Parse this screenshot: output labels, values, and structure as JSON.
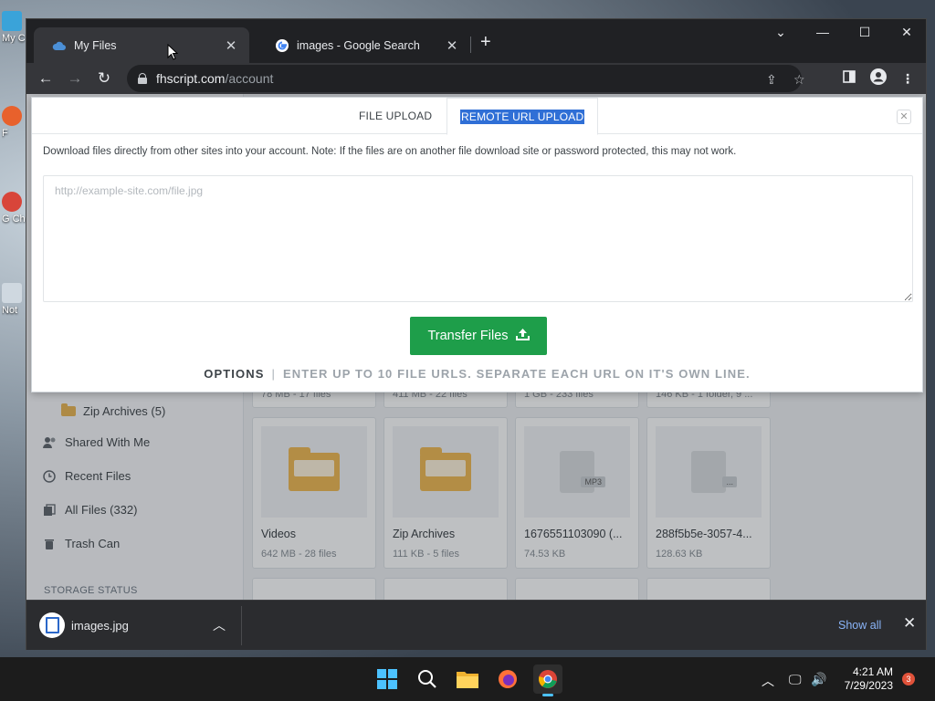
{
  "desktop": {
    "icons": [
      {
        "label": "My C"
      },
      {
        "label": "F"
      },
      {
        "label": "G Ch"
      },
      {
        "label": "Not"
      }
    ]
  },
  "browser": {
    "tabs": [
      {
        "title": "My Files",
        "close": "✕"
      },
      {
        "title": "images - Google Search",
        "close": "✕"
      }
    ],
    "new_tab": "+",
    "window_controls": {
      "tab_search": "⌄",
      "minimize": "—",
      "maximize": "☐",
      "close": "✕"
    },
    "url_host": "fhscript.com",
    "url_path": "/account"
  },
  "sidebar": {
    "zip_archives": "Zip Archives (5)",
    "shared_with_me": "Shared With Me",
    "recent_files": "Recent Files",
    "all_files": "All Files (332)",
    "trash_can": "Trash Can",
    "storage_status": "STORAGE STATUS"
  },
  "grid": {
    "top_row_meta": [
      "78 MB - 17 files",
      "411 MB - 22 files",
      "1 GB - 233 files",
      "146 KB - 1 folder, 9 ..."
    ],
    "cards": [
      {
        "name": "Videos",
        "meta": "642 MB - 28 files",
        "kind": "folder"
      },
      {
        "name": "Zip Archives",
        "meta": "111 KB - 5 files",
        "kind": "folder"
      },
      {
        "name": "1676551103090 (...",
        "meta": "74.53 KB",
        "kind": "mp3",
        "tag": "MP3"
      },
      {
        "name": "288f5b5e-3057-4...",
        "meta": "128.63 KB",
        "kind": "file",
        "tag": "..."
      }
    ]
  },
  "modal": {
    "tab_file_upload": "FILE UPLOAD",
    "tab_remote_url": "REMOTE URL UPLOAD",
    "close": "✕",
    "description": "Download files directly from other sites into your account. Note: If the files are on another file download site or password protected, this may not work.",
    "url_placeholder": "http://example-site.com/file.jpg",
    "transfer_button": "Transfer Files",
    "options_label": "OPTIONS",
    "options_sep": "|",
    "options_hint": "ENTER UP TO 10 FILE URLS. SEPARATE EACH URL ON IT'S OWN LINE."
  },
  "downloads": {
    "file_name": "images.jpg",
    "show_all": "Show all",
    "close": "✕"
  },
  "taskbar": {
    "time": "4:21 AM",
    "date": "7/29/2023",
    "notification_count": "3"
  },
  "colors": {
    "accent_green": "#1e9e4a",
    "selection_blue": "#2f6fd6",
    "link_blue": "#8ab4f8",
    "folder_yellow": "#f0b64d"
  }
}
